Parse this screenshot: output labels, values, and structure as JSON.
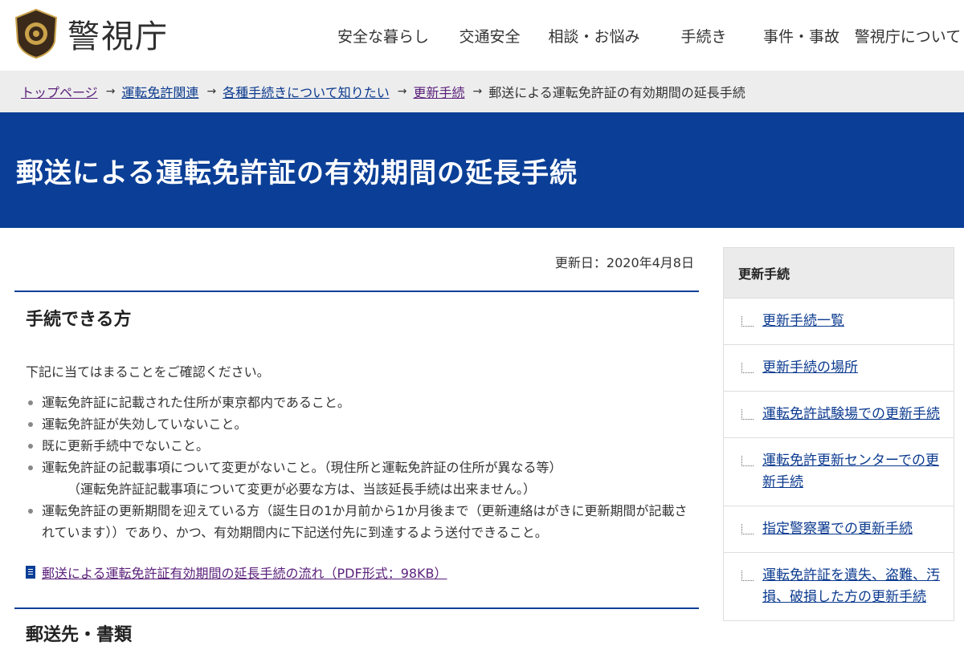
{
  "header": {
    "site_name": "警視庁",
    "nav": [
      "安全な暮らし",
      "交通安全",
      "相談・お悩み",
      "手続き",
      "事件・事故",
      "警視庁について"
    ]
  },
  "breadcrumb": {
    "items": [
      "トップページ",
      "運転免許関連",
      "各種手続きについて知りたい",
      "更新手続"
    ],
    "current": "郵送による運転免許証の有効期間の延長手続"
  },
  "page_title": "郵送による運転免許証の有効期間の延長手続",
  "updated": "更新日：2020年4月8日",
  "section": {
    "title": "手続できる方",
    "lead": "下記に当てはまることをご確認ください。",
    "conditions": [
      "運転免許証に記載された住所が東京都内であること。",
      "運転免許証が失効していないこと。",
      "既に更新手続中でないこと。",
      "運転免許証の記載事項について変更がないこと。（現住所と運転免許証の住所が異なる等）",
      "運転免許証の更新期間を迎えている方（誕生日の1か月前から1か月後まで（更新連絡はがきに更新期間が記載されています））であり、かつ、有効期間内に下記送付先に到達するよう送付できること。"
    ],
    "note": "（運転免許証記載事項について変更が必要な方は、当該延長手続は出来ません。）",
    "pdf_link": "郵送による運転免許証有効期間の延長手続の流れ（PDF形式：98KB）"
  },
  "next_section_title": "郵送先・書類",
  "sidebar": {
    "title": "更新手続",
    "items": [
      "更新手続一覧",
      "更新手続の場所",
      "運転免許試験場での更新手続",
      "運転免許更新センターでの更新手続",
      "指定警察署での更新手続",
      "運転免許証を遺失、盗難、汚損、破損した方の更新手続"
    ]
  }
}
